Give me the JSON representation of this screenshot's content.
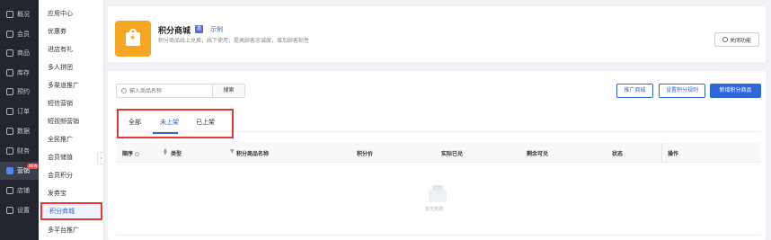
{
  "nav": {
    "items": [
      {
        "label": "概况",
        "icon": "grid-icon"
      },
      {
        "label": "会员",
        "icon": "user-icon"
      },
      {
        "label": "商品",
        "icon": "goods-icon"
      },
      {
        "label": "库存",
        "icon": "stock-icon"
      },
      {
        "label": "预约",
        "icon": "calendar-icon"
      },
      {
        "label": "订单",
        "icon": "order-icon"
      },
      {
        "label": "数据",
        "icon": "chart-icon"
      },
      {
        "label": "财务",
        "icon": "finance-icon"
      },
      {
        "label": "营销",
        "icon": "marketing-icon",
        "active": true,
        "badge": "NEW"
      },
      {
        "label": "店铺",
        "icon": "store-icon"
      },
      {
        "label": "设置",
        "icon": "settings-icon"
      }
    ]
  },
  "submenu": {
    "items": [
      "应用中心",
      "优惠券",
      "进店有礼",
      "多人拼团",
      "多渠道推广",
      "短信营销",
      "短视频营销",
      "全民推广",
      "会员储值",
      "会员积分",
      "发券宝",
      "积分商城",
      "多平台推广"
    ],
    "selected_index": 11,
    "collapse_glyph": "‹"
  },
  "header": {
    "title": "积分商城",
    "tag": "基",
    "example_link": "示例",
    "description": "积分商品线上兑换，线下使用；提高顾客忠诚度，增加顾客粘性",
    "close_button": "关闭功能"
  },
  "toolbar": {
    "search_placeholder": "输入商品名称",
    "search_button": "搜索",
    "promote_button": "推广商城",
    "rules_button": "设置积分规则",
    "add_button": "新增积分商品"
  },
  "tabs": [
    {
      "label": "全部"
    },
    {
      "label": "未上架",
      "active": true
    },
    {
      "label": "已上架"
    }
  ],
  "table": {
    "columns": [
      "顺序",
      "类型",
      "积分商品名称",
      "积分价",
      "实际已兑",
      "剩余可兑",
      "状态",
      "操作"
    ],
    "empty_text": "暂无数据"
  },
  "colors": {
    "accent": "#2f66d8",
    "highlight_border": "#e53935",
    "app_icon": "#f5a623",
    "nav_bg": "#23262e"
  }
}
